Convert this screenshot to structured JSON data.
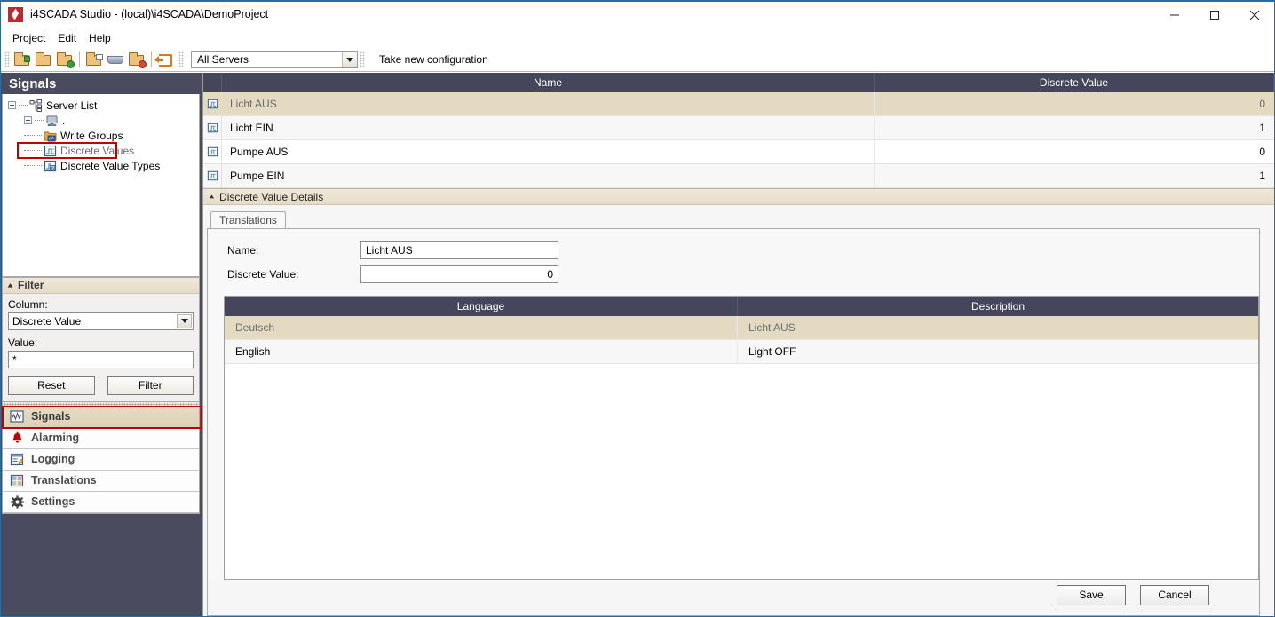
{
  "window": {
    "title": "i4SCADA Studio - (local)\\i4SCADA\\DemoProject",
    "logo_icon": "i4scada-diamond-logo",
    "minimize_label": "─",
    "maximize_label": "□",
    "close_label": "✕"
  },
  "menubar": {
    "items": [
      {
        "label": "Project"
      },
      {
        "label": "Edit"
      },
      {
        "label": "Help"
      }
    ]
  },
  "toolbar": {
    "icons": [
      {
        "name": "new-project-icon"
      },
      {
        "name": "open-project-icon"
      },
      {
        "name": "save-project-icon"
      },
      {
        "name": "import-icon"
      },
      {
        "name": "export-icon"
      },
      {
        "name": "delete-project-icon"
      },
      {
        "name": "logout-icon"
      }
    ],
    "server_combo": {
      "value": "All Servers"
    },
    "take_new_configuration": "Take new configuration"
  },
  "sidebar": {
    "title": "Signals",
    "tree": [
      {
        "label": "Server List",
        "icon": "server-list-icon",
        "level": 0,
        "expander": "minus",
        "selected": false
      },
      {
        "label": ".",
        "icon": "server-node-icon",
        "level": 1,
        "expander": "plus",
        "selected": false
      },
      {
        "label": "Write Groups",
        "icon": "write-groups-folder-icon",
        "level": 1,
        "expander": "none",
        "selected": false
      },
      {
        "label": "Discrete Values",
        "icon": "discrete-values-icon",
        "level": 1,
        "expander": "none",
        "selected": true
      },
      {
        "label": "Discrete Value Types",
        "icon": "discrete-value-types-icon",
        "level": 1,
        "expander": "none",
        "selected": false
      }
    ],
    "filter": {
      "header": "Filter",
      "column_label": "Column:",
      "column_value": "Discrete Value",
      "value_label": "Value:",
      "value_text": "*",
      "reset_button": "Reset",
      "filter_button": "Filter"
    },
    "nav": [
      {
        "label": "Signals",
        "icon": "signals-waveform-icon",
        "selected": true
      },
      {
        "label": "Alarming",
        "icon": "alarm-bell-icon",
        "selected": false
      },
      {
        "label": "Logging",
        "icon": "logging-icon",
        "selected": false
      },
      {
        "label": "Translations",
        "icon": "translations-icon",
        "selected": false
      },
      {
        "label": "Settings",
        "icon": "gear-icon",
        "selected": false
      }
    ]
  },
  "grid": {
    "columns": [
      "",
      "Name",
      "Discrete Value"
    ],
    "rows": [
      {
        "icon": "discrete-value-row-icon",
        "name": "Licht AUS",
        "value": "0",
        "selected": true
      },
      {
        "icon": "discrete-value-row-icon",
        "name": "Licht EIN",
        "value": "1",
        "selected": false
      },
      {
        "icon": "discrete-value-row-icon",
        "name": "Pumpe AUS",
        "value": "0",
        "selected": false
      },
      {
        "icon": "discrete-value-row-icon",
        "name": "Pumpe EIN",
        "value": "1",
        "selected": false
      }
    ]
  },
  "details": {
    "header": "Discrete Value Details",
    "tabs": [
      {
        "label": "Translations",
        "active": true
      }
    ],
    "form": {
      "name_label": "Name:",
      "name_value": "Licht AUS",
      "discrete_value_label": "Discrete Value:",
      "discrete_value": "0"
    },
    "translations_table": {
      "columns": [
        "Language",
        "Description"
      ],
      "rows": [
        {
          "language": "Deutsch",
          "description": "Licht AUS",
          "selected": true
        },
        {
          "language": "English",
          "description": "Light OFF",
          "selected": false
        }
      ]
    },
    "save_button": "Save",
    "cancel_button": "Cancel"
  },
  "colors": {
    "header_dark": "#45465c",
    "panel_dark": "#4a4b5e",
    "selection_tan": "#e4dac2",
    "highlight_red": "#c00000",
    "accent_blue": "#2b6ca3"
  }
}
